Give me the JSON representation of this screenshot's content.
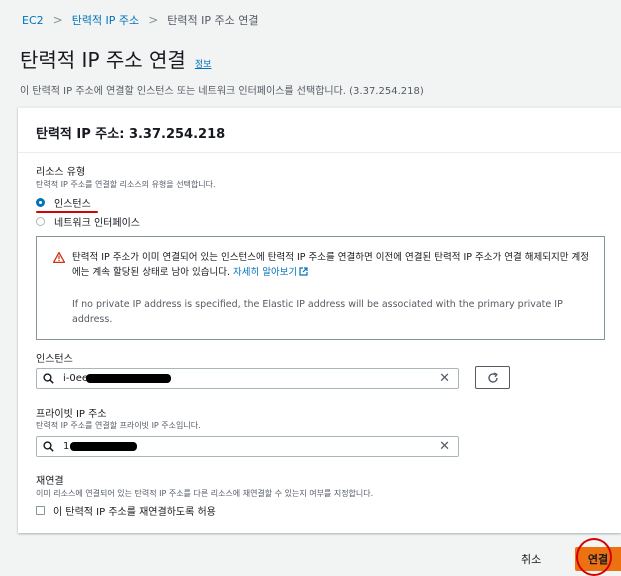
{
  "breadcrumb": {
    "items": [
      "EC2",
      "탄력적 IP 주소",
      "탄력적 IP 주소 연결"
    ]
  },
  "page": {
    "title": "탄력적 IP 주소 연결",
    "info_link": "정보",
    "description": "이 탄력적 IP 주소에 연결할 인스턴스 또는 네트워크 인터페이스를 선택합니다. (3.37.254.218)"
  },
  "panel": {
    "title": "탄력적 IP 주소: 3.37.254.218"
  },
  "resource_type": {
    "label": "리소스 유형",
    "hint": "탄력적 IP 주소를 연결할 리소스의 유형을 선택합니다.",
    "options": [
      {
        "label": "인스턴스",
        "selected": true
      },
      {
        "label": "네트워크 인터페이스",
        "selected": false
      }
    ]
  },
  "alert": {
    "text_ko": "탄력적 IP 주소가 이미 연결되어 있는 인스턴스에 탄력적 IP 주소를 연결하면 이전에 연결된 탄력적 IP 주소가 연결 해제되지만 계정에는 계속 할당된 상태로 남아 있습니다.",
    "learn_more": "자세히 알아보기",
    "text_en": "If no private IP address is specified, the Elastic IP address will be associated with the primary private IP address."
  },
  "instance": {
    "label": "인스턴스",
    "value": "i-0ee"
  },
  "private_ip": {
    "label": "프라이빗 IP 주소",
    "hint": "탄력적 IP 주소를 연결할 프라이빗 IP 주소입니다.",
    "value": "1"
  },
  "reassociate": {
    "label": "재연결",
    "hint": "이미 리소스에 연결되어 있는 탄력적 IP 주소를 다른 리소스에 재연결할 수 있는지 여부를 지정합니다.",
    "checkbox_label": "이 탄력적 IP 주소를 재연결하도록 허용",
    "checked": false
  },
  "footer": {
    "cancel_label": "취소",
    "connect_label": "연결"
  },
  "colors": {
    "link": "#0073bb",
    "primary_button": "#ec7211",
    "annotation_red": "#d50000",
    "warning": "#d13212"
  },
  "icons": {
    "warning": "warning-icon",
    "search": "search-icon",
    "clear": "clear-icon",
    "refresh": "refresh-icon",
    "external_link": "external-link-icon"
  }
}
